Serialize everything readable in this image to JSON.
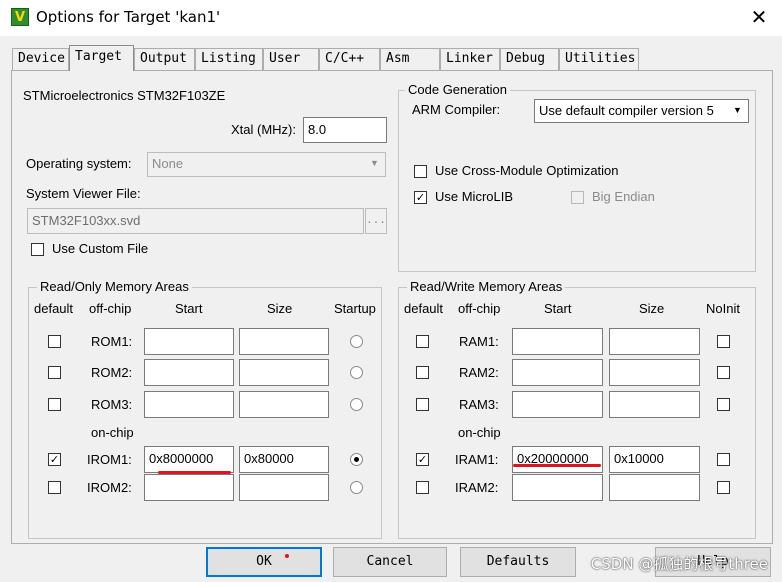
{
  "window": {
    "title": "Options for Target 'kan1'",
    "app_icon": "V",
    "close_glyph": "✕"
  },
  "tabs": [
    "Device",
    "Target",
    "Output",
    "Listing",
    "User",
    "C/C++",
    "Asm",
    "Linker",
    "Debug",
    "Utilities"
  ],
  "active_tab": "Target",
  "target": {
    "device_name": "STMicroelectronics STM32F103ZE",
    "xtal_label": "Xtal (MHz):",
    "xtal_value": "8.0",
    "os_label": "Operating system:",
    "os_value": "None",
    "svd_label": "System Viewer File:",
    "svd_value": "STM32F103xx.svd",
    "browse_label": "...",
    "custom_file_label": "Use Custom File"
  },
  "codegen": {
    "title": "Code Generation",
    "compiler_label": "ARM Compiler:",
    "compiler_value": "Use default compiler version 5",
    "cross_module_label": "Use Cross-Module Optimization",
    "microlib_label": "Use MicroLIB",
    "big_endian_label": "Big Endian"
  },
  "rom": {
    "title": "Read/Only Memory Areas",
    "headers": {
      "default": "default",
      "offchip": "off-chip",
      "start": "Start",
      "size": "Size",
      "startup": "Startup"
    },
    "onchip_label": "on-chip",
    "rows": [
      {
        "label": "ROM1:",
        "start": "",
        "size": ""
      },
      {
        "label": "ROM2:",
        "start": "",
        "size": ""
      },
      {
        "label": "ROM3:",
        "start": "",
        "size": ""
      },
      {
        "label": "IROM1:",
        "start": "0x8000000",
        "size": "0x80000"
      },
      {
        "label": "IROM2:",
        "start": "",
        "size": ""
      }
    ]
  },
  "ram": {
    "title": "Read/Write Memory Areas",
    "headers": {
      "default": "default",
      "offchip": "off-chip",
      "start": "Start",
      "size": "Size",
      "noinit": "NoInit"
    },
    "onchip_label": "on-chip",
    "rows": [
      {
        "label": "RAM1:",
        "start": "",
        "size": ""
      },
      {
        "label": "RAM2:",
        "start": "",
        "size": ""
      },
      {
        "label": "RAM3:",
        "start": "",
        "size": ""
      },
      {
        "label": "IRAM1:",
        "start": "0x20000000",
        "size": "0x10000"
      },
      {
        "label": "IRAM2:",
        "start": "",
        "size": ""
      }
    ]
  },
  "buttons": {
    "ok": "OK",
    "cancel": "Cancel",
    "defaults": "Defaults",
    "help": "Help"
  },
  "watermark": "CSDN @孤独的根号three",
  "colors": {
    "annotation": "#e0141e",
    "focus": "#0078d7"
  }
}
